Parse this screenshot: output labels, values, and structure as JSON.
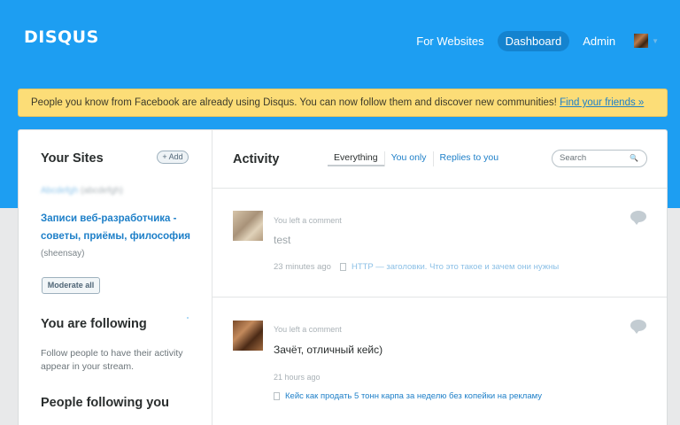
{
  "header": {
    "logo": "DISQUS",
    "nav": [
      "For Websites",
      "Dashboard",
      "Admin"
    ],
    "active_nav": "Dashboard",
    "brand_color": "#1d9ef2"
  },
  "notice": {
    "text": "People you know from Facebook are already using Disqus. You can now follow them and discover new communities!",
    "link": "Find your friends »"
  },
  "sidebar": {
    "sites_title": "Your Sites",
    "add_label": "+ Add",
    "blurred_site": "Abcdefgh",
    "blurred_owner": "(abcdefgh)",
    "site_name": "Записи веб-разработчика - советы, приёмы, философия",
    "site_owner": "(sheensay)",
    "moderate_label": "Moderate all",
    "following_title": "You are following",
    "following_text": "Follow people to have their activity appear in your stream.",
    "followers_title": "People following you"
  },
  "activity": {
    "title": "Activity",
    "tabs": [
      "Everything",
      "You only",
      "Replies to you"
    ],
    "search_placeholder": "Search",
    "posts": [
      {
        "meta": "You left a comment",
        "body": "test",
        "time": "23 minutes ago",
        "thread": "HTTP — заголовки. Что это такое и зачем они нужны"
      },
      {
        "meta": "You left a comment",
        "body": "Зачёт, отличный кейс)",
        "time": "21 hours ago",
        "thread": "Кейс как продать 5 тонн карпа за неделю без копейки на рекламу"
      }
    ]
  }
}
